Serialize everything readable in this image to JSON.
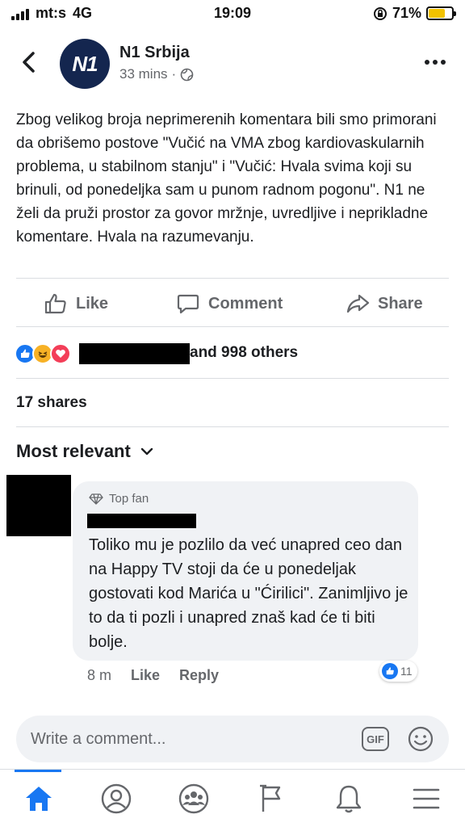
{
  "status_bar": {
    "carrier": "mt:s",
    "network": "4G",
    "time": "19:09",
    "battery": "71%",
    "battery_level": 0.71
  },
  "post": {
    "page_name": "N1 Srbija",
    "avatar_text": "N1",
    "time": "33 mins",
    "text": "Zbog velikog broja neprimerenih komentara bili smo primorani da obrišemo postove \"Vučić na VMA zbog kardiovaskularnih problema, u stabilnom stanju\" i \"Vučić: Hvala svima koji su brinuli, od ponedeljka sam u punom radnom pogonu\". N1 ne želi da pruži prostor za govor mržnje, uvredljive i neprikladne komentare. Hvala na razumevanju."
  },
  "actions": {
    "like": "Like",
    "comment": "Comment",
    "share": "Share"
  },
  "reactions": {
    "summary": "and 998 others",
    "shares": "17 shares"
  },
  "comments": {
    "sort_label": "Most relevant",
    "items": [
      {
        "badge": "Top fan",
        "text": "Toliko mu je pozlilo da već unapred ceo dan na Happy TV stoji da će u ponedeljak gostovati kod Marića u \"Ćirilici\". Zanimljivo je to da ti pozli i unapred znaš kad će ti biti bolje.",
        "time": "8 m",
        "like_label": "Like",
        "reply_label": "Reply",
        "reaction_count": "11"
      }
    ]
  },
  "composer": {
    "placeholder": "Write a comment...",
    "gif_label": "GIF"
  },
  "nav": {
    "items": [
      "home-icon",
      "profile-icon",
      "groups-icon",
      "pages-icon",
      "notifications-icon",
      "menu-icon"
    ]
  },
  "colors": {
    "accent": "#1877f2",
    "muted_text": "#65676b",
    "bubble": "#f0f2f5"
  }
}
